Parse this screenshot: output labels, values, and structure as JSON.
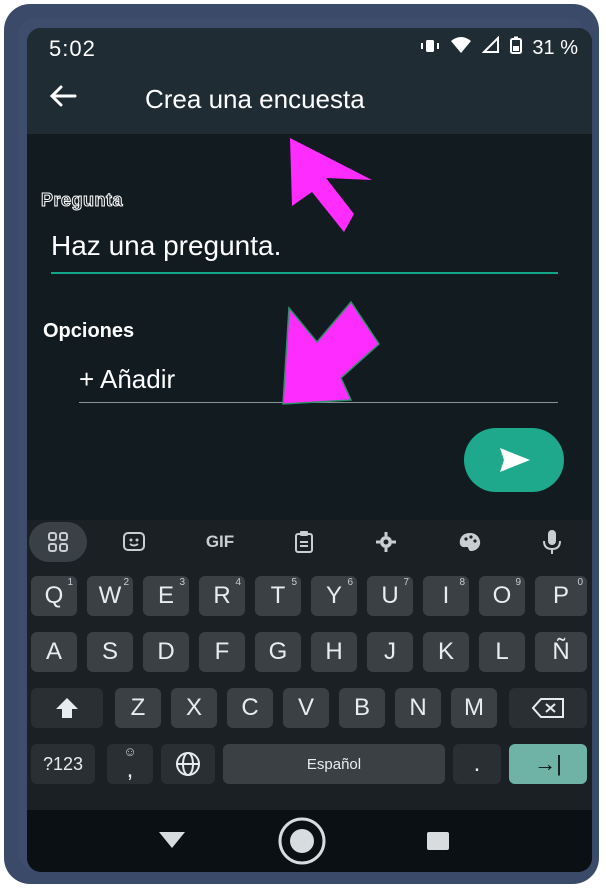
{
  "status": {
    "time": "5:02",
    "battery": "31 %"
  },
  "appbar": {
    "title": "Crea una encuesta"
  },
  "question": {
    "label": "Pregunta",
    "placeholder": "Haz una pregunta."
  },
  "options": {
    "label": "Opciones",
    "add": "+ Añadir"
  },
  "keyboard": {
    "tools": [
      "GIF"
    ],
    "row1": [
      {
        "k": "Q",
        "h": "1"
      },
      {
        "k": "W",
        "h": "2"
      },
      {
        "k": "E",
        "h": "3"
      },
      {
        "k": "R",
        "h": "4"
      },
      {
        "k": "T",
        "h": "5"
      },
      {
        "k": "Y",
        "h": "6"
      },
      {
        "k": "U",
        "h": "7"
      },
      {
        "k": "I",
        "h": "8"
      },
      {
        "k": "O",
        "h": "9"
      },
      {
        "k": "P",
        "h": "0"
      }
    ],
    "row2": [
      "A",
      "S",
      "D",
      "F",
      "G",
      "H",
      "J",
      "K",
      "L",
      "Ñ"
    ],
    "row3": [
      "Z",
      "X",
      "C",
      "V",
      "B",
      "N",
      "M"
    ],
    "sym": "?123",
    "comma": ",",
    "space": "Español",
    "period": ".",
    "enter": "→|"
  },
  "colors": {
    "accent": "#1ea98c",
    "annotation": "#ff2cff",
    "bar": "#1f2c33"
  }
}
